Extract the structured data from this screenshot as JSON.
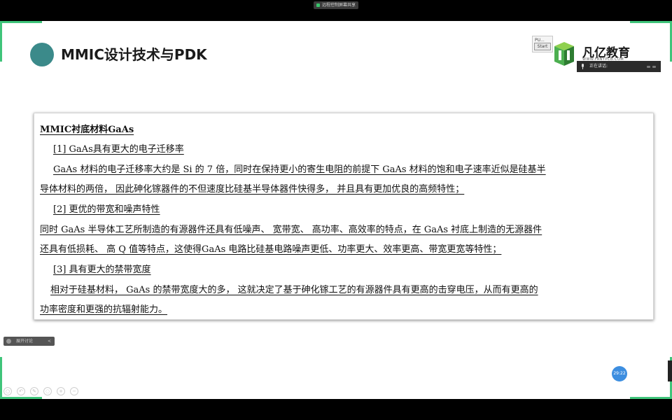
{
  "share_badge": "远程控制屏幕共享",
  "slide": {
    "title": "MMIC设计技术与PDK",
    "start_widget": {
      "top_text": "PU...",
      "button": "Start"
    },
    "logo": {
      "name": "凡亿教育",
      "url": "WWW.FANYPCB.COM"
    },
    "speaking": {
      "label": "正在讲话:"
    },
    "content": {
      "heading": "MMIC衬底材料GaAs",
      "lines": [
        "[1] GaAs具有更大的电子迁移率",
        "GaAs 材料的电子迁移率大约是 Si 的 7 倍，同时在保持更小的寄生电阻的前提下 GaAs 材料的饱和电子速率近似是硅基半",
        "导体材料的两倍， 因此砷化镓器件的不但速度比硅基半导体器件快得多， 并且具有更加优良的高频特性；",
        "[2] 更优的带宽和噪声特性",
        "同时 GaAs 半导体工艺所制造的有源器件还具有低噪声、 宽带宽、 高功率、高效率的特点，在 GaAs 衬底上制造的无源器件",
        "还具有低损耗、 高 Q 值等特点，这使得GaAs 电路比硅基电路噪声更低、功率更大、效率更高、带宽更宽等特性；",
        "[3] 具有更大的禁带宽度",
        "相对于硅基材料， GaAs 的禁带宽度大的多， 这就决定了基于砷化镓工艺的有源器件具有更高的击穿电压，从而有更高的",
        "功率密度和更强的抗辐射能力。"
      ]
    },
    "float_button": {
      "label": "展开讨论",
      "chevron": "<"
    },
    "time_badge": "29:22",
    "toolbar_icons": [
      "circle-icon",
      "undo-icon",
      "pen-icon",
      "eraser-icon",
      "zoom-in-icon",
      "zoom-out-icon"
    ]
  },
  "colors": {
    "accent_green": "#3fc47a",
    "title_circle": "#3b8a8a",
    "time_badge": "#3d8ee0"
  }
}
